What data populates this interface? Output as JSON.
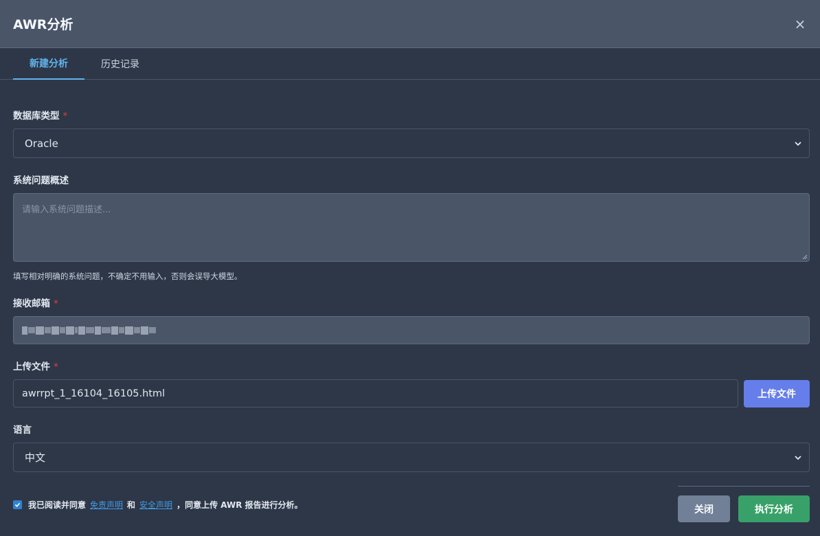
{
  "dialog": {
    "title": "AWR分析",
    "close_glyph": "×"
  },
  "tabs": [
    {
      "label": "新建分析",
      "active": true
    },
    {
      "label": "历史记录",
      "active": false
    }
  ],
  "form": {
    "db_type": {
      "label": "数据库类型",
      "required_mark": "*",
      "value": "Oracle"
    },
    "problem": {
      "label": "系统问题概述",
      "placeholder": "请输入系统问题描述...",
      "help": "填写相对明确的系统问题，不确定不用输入，否则会误导大模型。"
    },
    "email": {
      "label": "接收邮箱",
      "required_mark": "*"
    },
    "file": {
      "label": "上传文件",
      "required_mark": "*",
      "value": "awrrpt_1_16104_16105.html",
      "button": "上传文件"
    },
    "language": {
      "label": "语言",
      "value": "中文"
    }
  },
  "agreement": {
    "prefix": "我已阅读并同意",
    "link1": "免责声明",
    "conj": "和",
    "link2": "安全声明",
    "suffix": "，同意上传 AWR 报告进行分析。",
    "checked": true
  },
  "buttons": {
    "close": "关闭",
    "run": "执行分析"
  },
  "colors": {
    "accent": "#63b3ed",
    "primary": "#667eea",
    "success": "#38a169",
    "required": "#e53e3e"
  }
}
